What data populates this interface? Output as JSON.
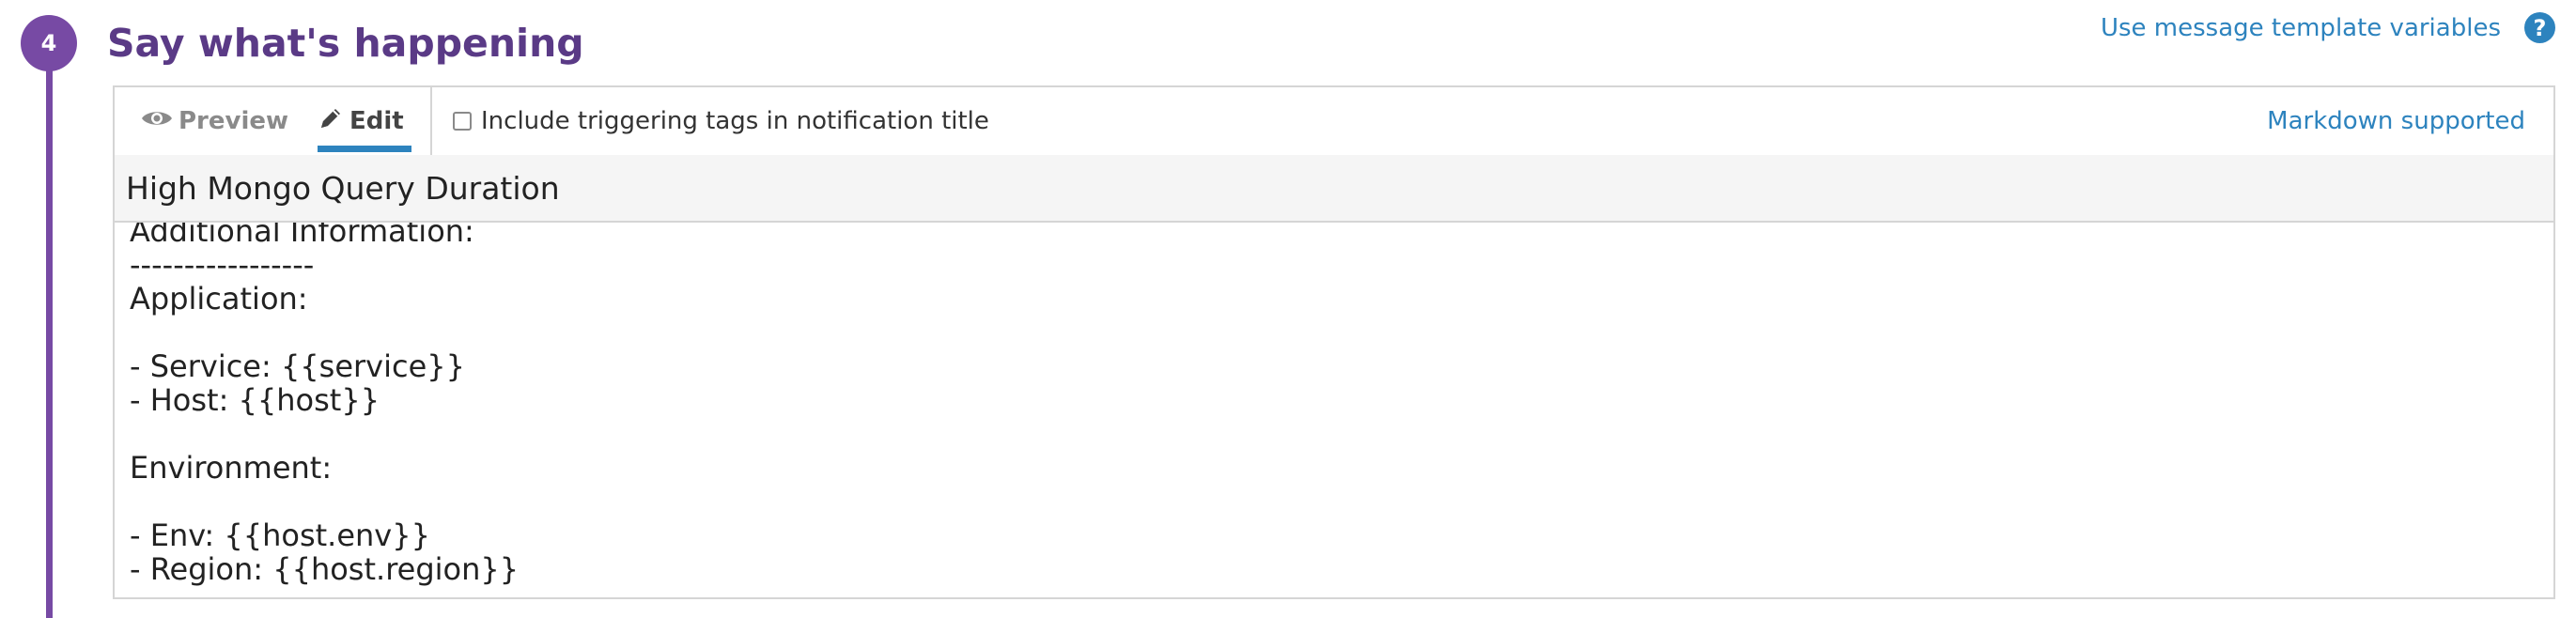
{
  "step": {
    "number": "4",
    "title": "Say what's happening"
  },
  "header": {
    "template_link": "Use message template variables",
    "help_symbol": "?"
  },
  "toolbar": {
    "preview_label": "Preview",
    "edit_label": "Edit",
    "active_tab": "Edit",
    "checkbox_label": "Include triggering tags in notification title",
    "checkbox_checked": false,
    "markdown_note": "Markdown supported"
  },
  "message": {
    "title_value": "High Mongo Query Duration",
    "body_lines": [
      "Additional Information:",
      "-----------------",
      "Application:",
      "",
      "- Service: {{service}}",
      "- Host: {{host}}",
      "",
      "Environment:",
      "",
      "- Env: {{host.env}}",
      "- Region: {{host.region}}"
    ]
  },
  "colors": {
    "accent_purple": "#774aa4",
    "title_purple": "#5a3a86",
    "link_blue": "#2d83be",
    "border_gray": "#d5d5d5"
  },
  "icons": {
    "preview": "eye-icon",
    "edit": "pencil-icon",
    "help": "question-circle-icon"
  }
}
